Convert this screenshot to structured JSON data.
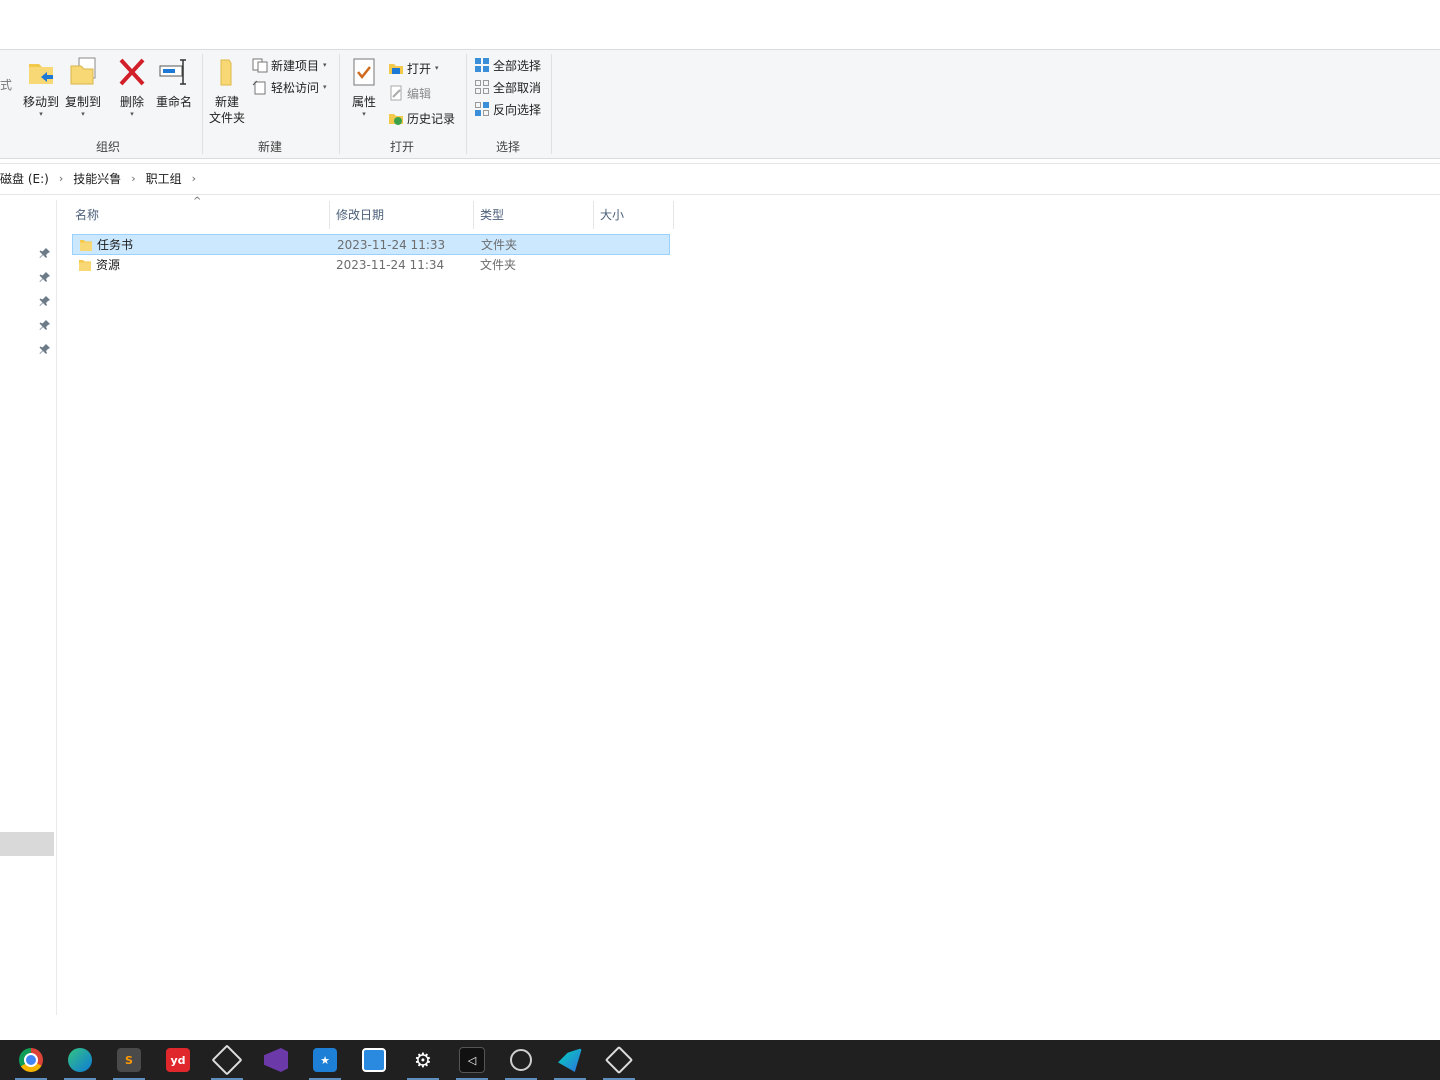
{
  "ribbon": {
    "edge_glyph": "式",
    "organize": {
      "label": "组织",
      "move_to": "移动到",
      "copy_to": "复制到",
      "delete": "删除",
      "rename": "重命名"
    },
    "new": {
      "label": "新建",
      "new_folder_line1": "新建",
      "new_folder_line2": "文件夹",
      "new_item": "新建项目",
      "easy_access": "轻松访问"
    },
    "open": {
      "label": "打开",
      "properties": "属性",
      "open": "打开",
      "edit": "编辑",
      "history": "历史记录"
    },
    "select": {
      "label": "选择",
      "select_all": "全部选择",
      "select_none": "全部取消",
      "invert": "反向选择"
    }
  },
  "address": {
    "crumbs": [
      "磁盘 (E:)",
      "技能兴鲁",
      "职工组"
    ]
  },
  "columns": {
    "name": "名称",
    "date": "修改日期",
    "type": "类型",
    "size": "大小"
  },
  "files": [
    {
      "name": "任务书",
      "date": "2023-11-24 11:33",
      "type": "文件夹",
      "selected": true
    },
    {
      "name": "资源",
      "date": "2023-11-24 11:34",
      "type": "文件夹",
      "selected": false
    }
  ],
  "taskbar": {
    "apps": [
      {
        "icon": "chrome-icon",
        "color": "#db4437",
        "label": ""
      },
      {
        "icon": "edge-icon",
        "color": "#0f7ad8",
        "label": ""
      },
      {
        "icon": "sublime-icon",
        "color": "#4a4a4a",
        "label": "S"
      },
      {
        "icon": "youdao-icon",
        "color": "#e0272c",
        "label": "yd"
      },
      {
        "icon": "unity-icon",
        "color": "#dddddd",
        "label": ""
      },
      {
        "icon": "visual-studio-icon",
        "color": "#6c3aa8",
        "label": ""
      },
      {
        "icon": "star-app-icon",
        "color": "#1e7fd6",
        "label": "★"
      },
      {
        "icon": "dingtalk-icon",
        "color": "#2a8ae0",
        "label": ""
      },
      {
        "icon": "settings-icon",
        "color": "#ffffff",
        "label": "⚙"
      },
      {
        "icon": "vscode-like-icon",
        "color": "#111111",
        "label": "◁"
      },
      {
        "icon": "obs-icon",
        "color": "#cfcfcf",
        "label": ""
      },
      {
        "icon": "feishu-icon",
        "color": "#2f6fe0",
        "label": ""
      },
      {
        "icon": "unity-hub-icon",
        "color": "#dddddd",
        "label": ""
      }
    ]
  }
}
